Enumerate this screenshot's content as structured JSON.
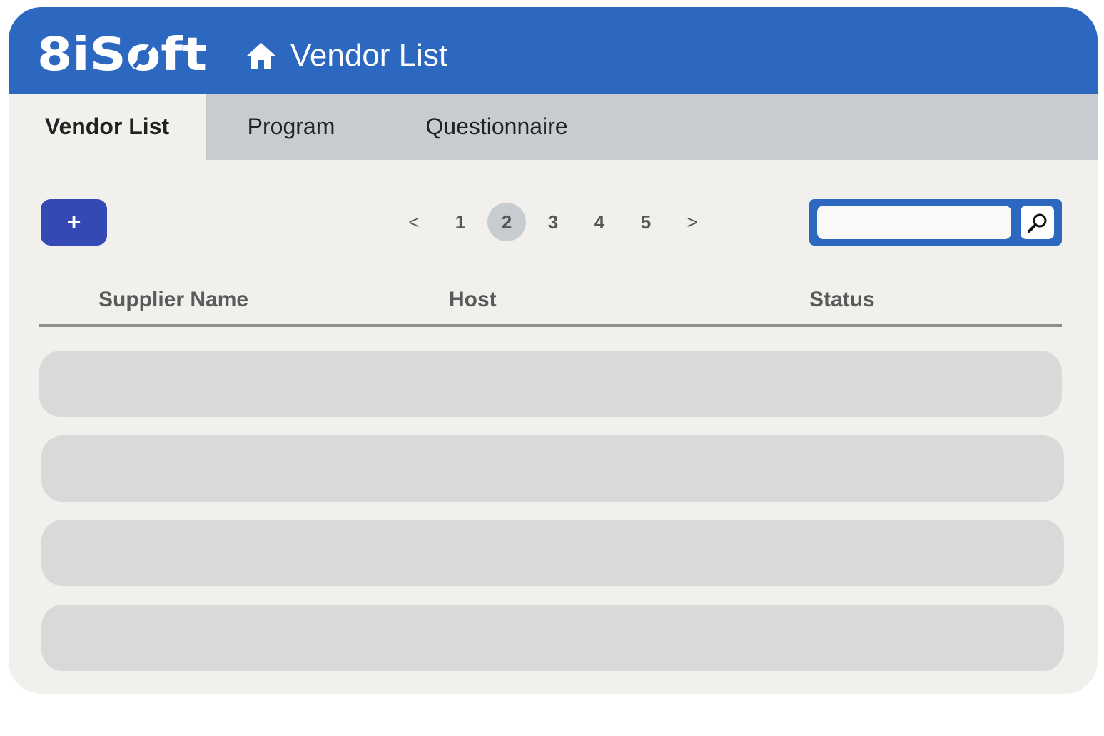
{
  "app": {
    "logo_text": "8iSoft",
    "page_title": "Vendor List"
  },
  "tabs": [
    {
      "label": "Vendor List",
      "active": true
    },
    {
      "label": "Program",
      "active": false
    },
    {
      "label": "Questionnaire",
      "active": false
    }
  ],
  "toolbar": {
    "add_label": "+"
  },
  "pagination": {
    "prev_label": "<",
    "next_label": ">",
    "pages": [
      "1",
      "2",
      "3",
      "4",
      "5"
    ],
    "current_page": "2"
  },
  "search": {
    "value": "",
    "placeholder": ""
  },
  "table": {
    "columns": [
      "Supplier Name",
      "Host",
      "Status"
    ],
    "rows": [
      {
        "supplier_name": "",
        "host": "",
        "status": ""
      },
      {
        "supplier_name": "",
        "host": "",
        "status": ""
      },
      {
        "supplier_name": "",
        "host": "",
        "status": ""
      },
      {
        "supplier_name": "",
        "host": "",
        "status": ""
      }
    ]
  },
  "colors": {
    "header_blue": "#2c68c0",
    "add_button": "#3449b4",
    "tab_bar": "#c8ccd1",
    "content_bg": "#f1f0ed",
    "row_placeholder": "#d9d9d9"
  },
  "icons": {
    "header": "home-icon",
    "search": "search-icon"
  }
}
